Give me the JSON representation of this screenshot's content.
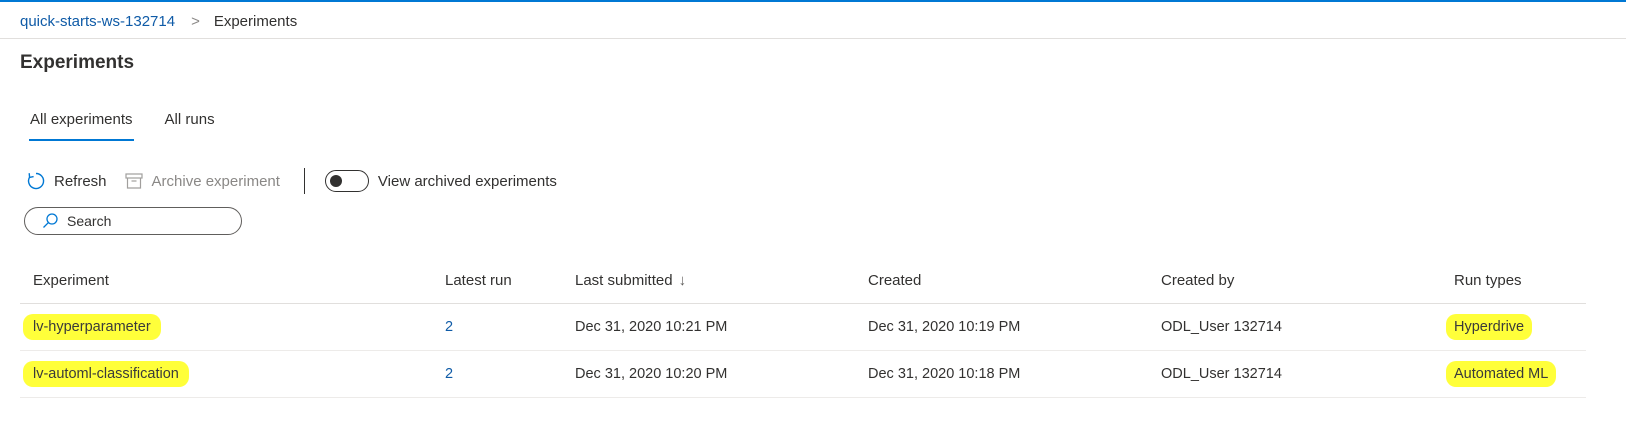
{
  "breadcrumb": {
    "workspace": "quick-starts-ws-132714",
    "separator": ">",
    "current": "Experiments"
  },
  "page": {
    "title": "Experiments"
  },
  "tabs": [
    {
      "label": "All experiments",
      "active": true
    },
    {
      "label": "All runs",
      "active": false
    }
  ],
  "toolbar": {
    "refresh_label": "Refresh",
    "archive_label": "Archive experiment",
    "toggle_label": "View archived experiments",
    "toggle_on": false
  },
  "search": {
    "placeholder": "Search"
  },
  "table": {
    "headers": {
      "experiment": "Experiment",
      "latest_run": "Latest run",
      "last_submitted": "Last submitted",
      "created": "Created",
      "created_by": "Created by",
      "run_types": "Run types"
    },
    "sort_indicator": "↓",
    "rows": [
      {
        "experiment": "lv-hyperparameter",
        "latest_run": "2",
        "last_submitted": "Dec 31, 2020 10:21 PM",
        "created": "Dec 31, 2020 10:19 PM",
        "created_by": "ODL_User 132714",
        "run_types": "Hyperdrive"
      },
      {
        "experiment": "lv-automl-classification",
        "latest_run": "2",
        "last_submitted": "Dec 31, 2020 10:20 PM",
        "created": "Dec 31, 2020 10:18 PM",
        "created_by": "ODL_User 132714",
        "run_types": "Automated ML"
      }
    ]
  },
  "colors": {
    "accent": "#0078d4",
    "link": "#0f5ba7",
    "highlight": "#ffff3a"
  }
}
